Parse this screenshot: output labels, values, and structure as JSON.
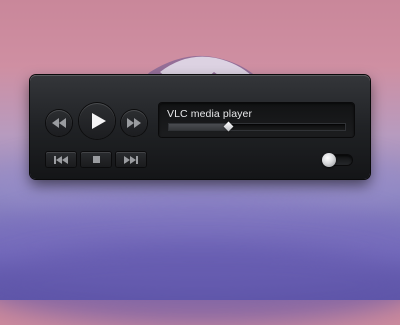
{
  "player": {
    "title": "VLC media player",
    "seek_progress": 0.34,
    "toggle_on": false
  },
  "icons": {
    "rewind": "rewind-icon",
    "play": "play-icon",
    "fast_forward": "fast-forward-icon",
    "previous": "skip-previous-icon",
    "stop": "stop-icon",
    "next": "skip-next-icon"
  },
  "colors": {
    "panel": "#202225",
    "icon": "#9a9ca0",
    "play_icon": "#f4f4f5",
    "text": "#e7e8ea"
  }
}
